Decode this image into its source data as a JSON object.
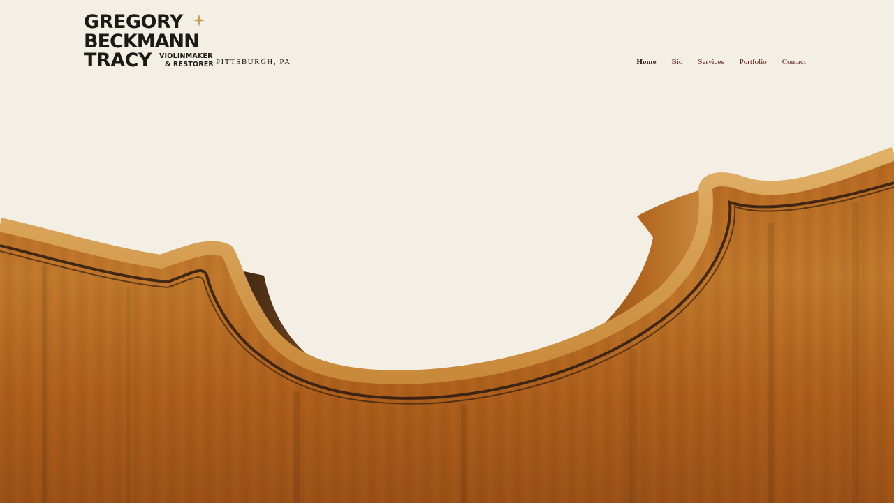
{
  "site": {
    "logo": {
      "line1": "GREGORY",
      "line2": "BECKMANN",
      "line3": "TRACY",
      "tagline1": "VIOLINMAKER",
      "tagline2": "& RESTORER",
      "icon": "sparkle-star-icon"
    },
    "location": "PITTSBURGH, PA"
  },
  "nav": {
    "items": [
      {
        "label": "Home",
        "active": true
      },
      {
        "label": "Bio",
        "active": false
      },
      {
        "label": "Services",
        "active": false
      },
      {
        "label": "Portfolio",
        "active": false
      },
      {
        "label": "Contact",
        "active": false
      }
    ]
  },
  "hero": {
    "image": "violin-body-corner-photo"
  },
  "colors": {
    "background": "#f3efe5",
    "text": "#1c1a17",
    "nav_link": "#5b1a14",
    "accent_gold": "#c89e58",
    "wood": "#b8651d"
  }
}
